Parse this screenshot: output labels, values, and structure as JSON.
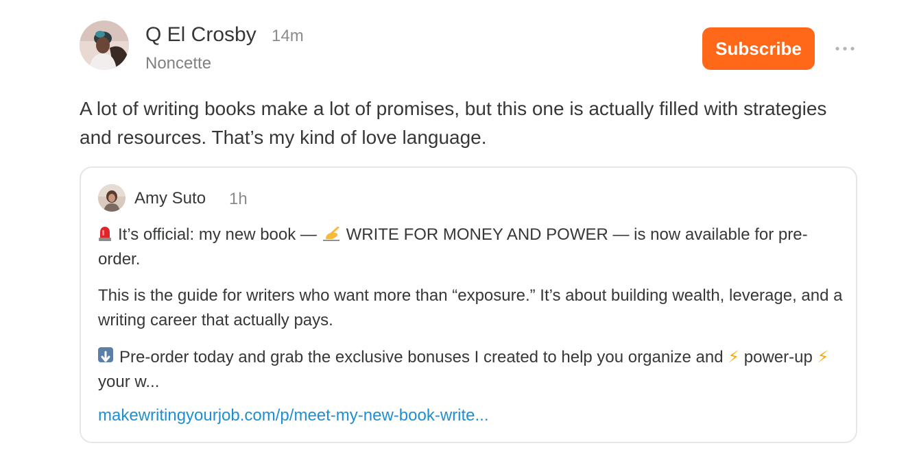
{
  "post": {
    "author_name": "Q El Crosby",
    "time": "14m",
    "publication": "Noncette",
    "subscribe_label": "Subscribe",
    "text": "A lot of writing books make a lot of promises, but this one is actually filled with strategies and resources. That’s my kind of love language."
  },
  "quoted": {
    "author_name": "Amy Suto",
    "time": "1h",
    "para1_prefix": "It’s official: my new book —",
    "para1_suffix": "WRITE FOR MONEY AND POWER — is now available for pre-order.",
    "para2": "This is the guide for writers who want more than “exposure.” It’s about building wealth, leverage, and a writing career that actually pays.",
    "para3_part1": "Pre-order today and grab the exclusive bonuses I created to help you organize and",
    "para3_part2": "power-up",
    "para3_part3": "your w...",
    "link_text": "makewritingyourjob.com/p/meet-my-new-book-write..."
  },
  "icons": {
    "bolt": "⚡",
    "siren": "siren-icon",
    "writing_hand": "writing-hand-icon",
    "down_arrow": "down-arrow-icon",
    "more": "more-icon"
  },
  "colors": {
    "accent": "#ff6719",
    "link": "#1f8fd1",
    "text": "#363737",
    "muted": "#8b8b8b"
  }
}
